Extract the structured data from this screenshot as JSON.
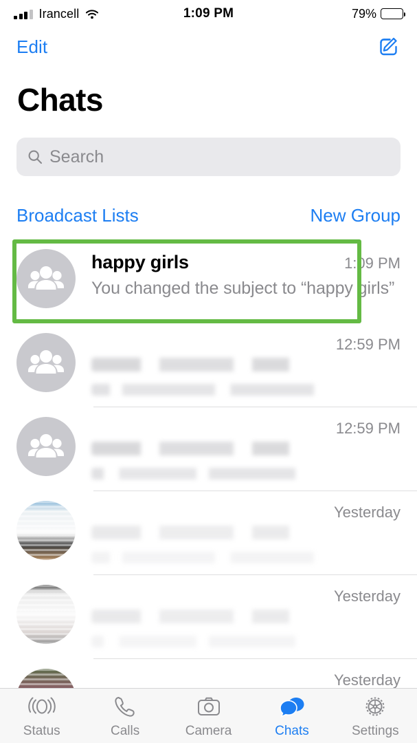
{
  "status_bar": {
    "carrier": "Irancell",
    "time": "1:09 PM",
    "battery_percent": "79%",
    "signal_bars_filled": 3,
    "wifi_icon": "wifi-icon"
  },
  "nav": {
    "edit_label": "Edit",
    "compose_icon": "compose-icon"
  },
  "page_title": "Chats",
  "search": {
    "placeholder": "Search",
    "value": "",
    "icon": "search-icon"
  },
  "actions": {
    "broadcast_lists": "Broadcast Lists",
    "new_group": "New Group"
  },
  "chats": [
    {
      "name": "happy girls",
      "preview": "You changed the subject to “happy girls”",
      "time": "1:09 PM",
      "avatar": "group-avatar",
      "redacted": false,
      "highlighted": true
    },
    {
      "name": "",
      "preview": "",
      "time": "12:59 PM",
      "avatar": "group-avatar",
      "redacted": true,
      "highlighted": false
    },
    {
      "name": "",
      "preview": "",
      "time": "12:59 PM",
      "avatar": "group-avatar",
      "redacted": true,
      "highlighted": false
    },
    {
      "name": "",
      "preview": "",
      "time": "Yesterday",
      "avatar": "photo-avatar",
      "redacted": true,
      "highlighted": false
    },
    {
      "name": "",
      "preview": "",
      "time": "Yesterday",
      "avatar": "photo-avatar",
      "redacted": true,
      "highlighted": false
    },
    {
      "name": "",
      "preview": "",
      "time": "Yesterday",
      "avatar": "photo-avatar",
      "redacted": true,
      "highlighted": false
    }
  ],
  "tabs": [
    {
      "label": "Status",
      "icon": "status-icon",
      "active": false
    },
    {
      "label": "Calls",
      "icon": "phone-icon",
      "active": false
    },
    {
      "label": "Camera",
      "icon": "camera-icon",
      "active": false
    },
    {
      "label": "Chats",
      "icon": "chats-icon",
      "active": true
    },
    {
      "label": "Settings",
      "icon": "gear-icon",
      "active": false
    }
  ],
  "colors": {
    "accent_blue": "#1d7ef2",
    "highlight_green": "#64ba44",
    "secondary_text": "#8a8a8e",
    "search_background": "#e9e9ec",
    "tabbar_background": "#f7f7f7"
  }
}
